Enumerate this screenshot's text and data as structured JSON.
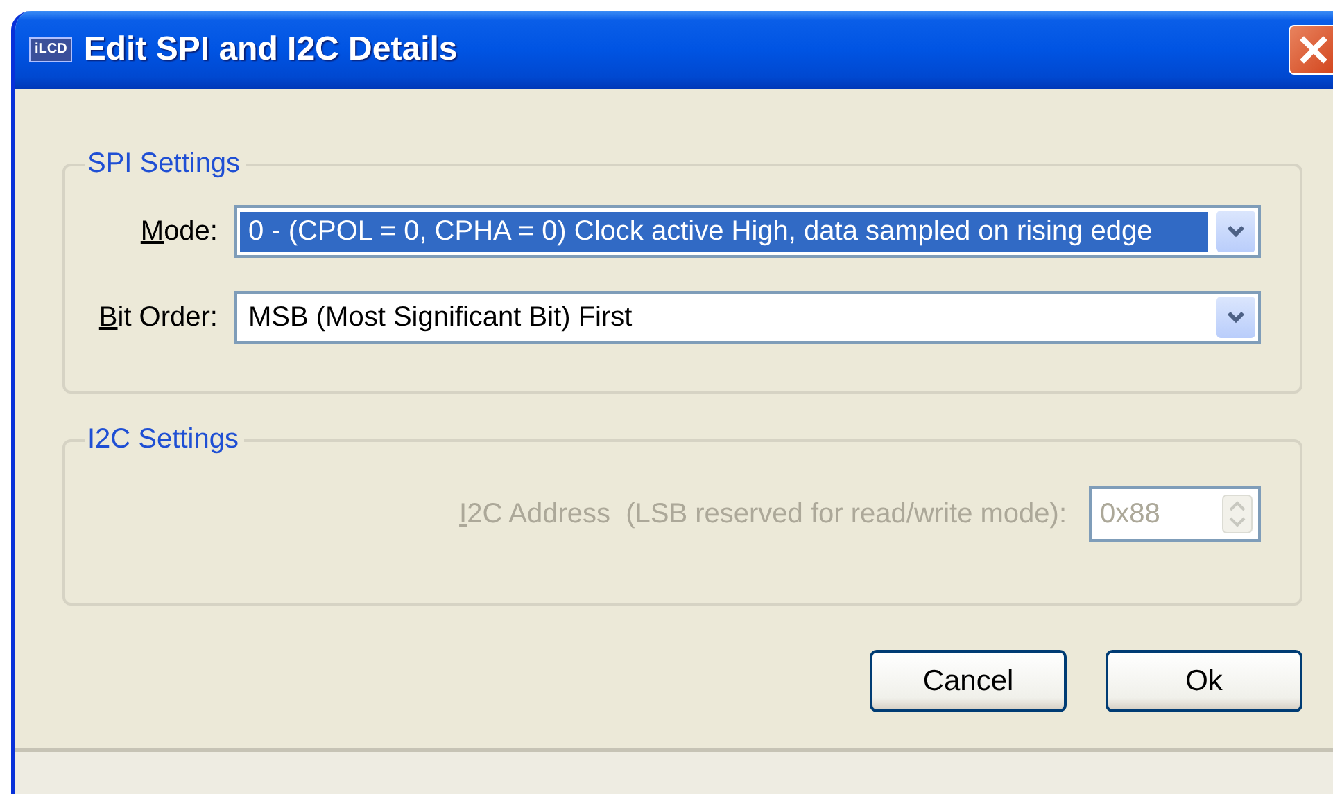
{
  "window": {
    "title": "Edit SPI and I2C Details",
    "app_icon": "iLCD"
  },
  "spi_settings": {
    "legend": "SPI Settings",
    "fields": [
      {
        "label": "Mode:",
        "first_letter_underlined": true,
        "value": "0 - (CPOL = 0, CPHA = 0) Clock active High, data sampled on rising edge",
        "highlighted": true
      },
      {
        "label": "Bit Order:",
        "first_letter_underlined": true,
        "value": "MSB (Most Significant Bit) First",
        "highlighted": false
      }
    ]
  },
  "i2c_settings": {
    "legend": "I2C Settings",
    "disabled": true,
    "address": {
      "label": "I2C Address  (LSB reserved for read/write mode):",
      "first_letter_underlined": true,
      "value": "0x88"
    }
  },
  "buttons": [
    "Cancel",
    "Ok"
  ]
}
